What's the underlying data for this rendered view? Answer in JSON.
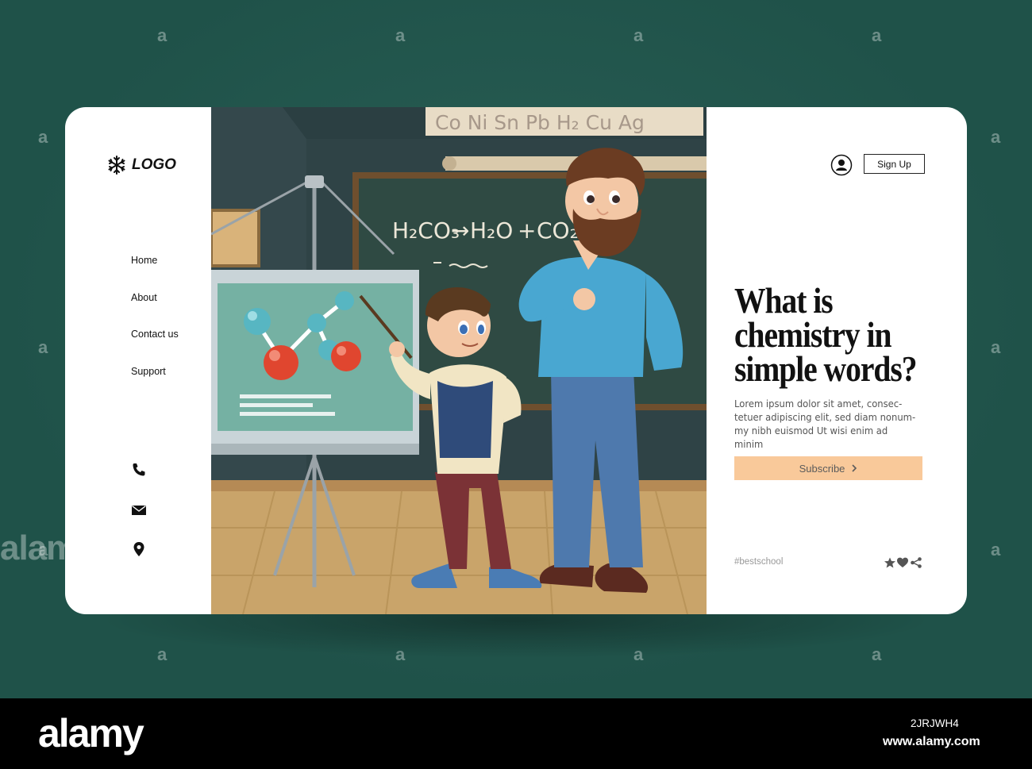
{
  "brand": {
    "logo_text": "LOGO",
    "logo_icon": "snowflake-icon"
  },
  "nav": {
    "items": [
      {
        "label": "Home"
      },
      {
        "label": "About"
      },
      {
        "label": "Contact us"
      },
      {
        "label": "Support"
      }
    ]
  },
  "contacts": {
    "icons": [
      "phone-icon",
      "mail-icon",
      "location-pin-icon"
    ]
  },
  "header": {
    "user_icon": "user-icon",
    "signup_label": "Sign Up"
  },
  "hero": {
    "title_lines": [
      "What is",
      "chemistry in",
      "simple words?"
    ],
    "description": "Lorem ipsum dolor sit amet, consec-tetuer adipiscing elit, sed diam nonum-my nibh euismod Ut wisi enim ad minim",
    "subscribe_label": "Subscribe",
    "hashtag": "#bestschool",
    "social_icons": [
      "star-icon",
      "heart-icon",
      "share-icon"
    ]
  },
  "illustration": {
    "element_symbols": "Co Ni Sn Pb H₂ Cu Ag",
    "formula_parts": [
      "H₂CO₃",
      "→",
      "H₂O",
      "+",
      "CO₂"
    ]
  },
  "stock": {
    "watermark": "a",
    "side_watermark": "alam",
    "brand": "alamy",
    "image_id": "2JRJWH4",
    "site": "www.alamy.com"
  },
  "colors": {
    "background": "#1f5249",
    "card": "#ffffff",
    "subscribe": "#f9c99a",
    "chalkboard": "#2f4a43"
  }
}
